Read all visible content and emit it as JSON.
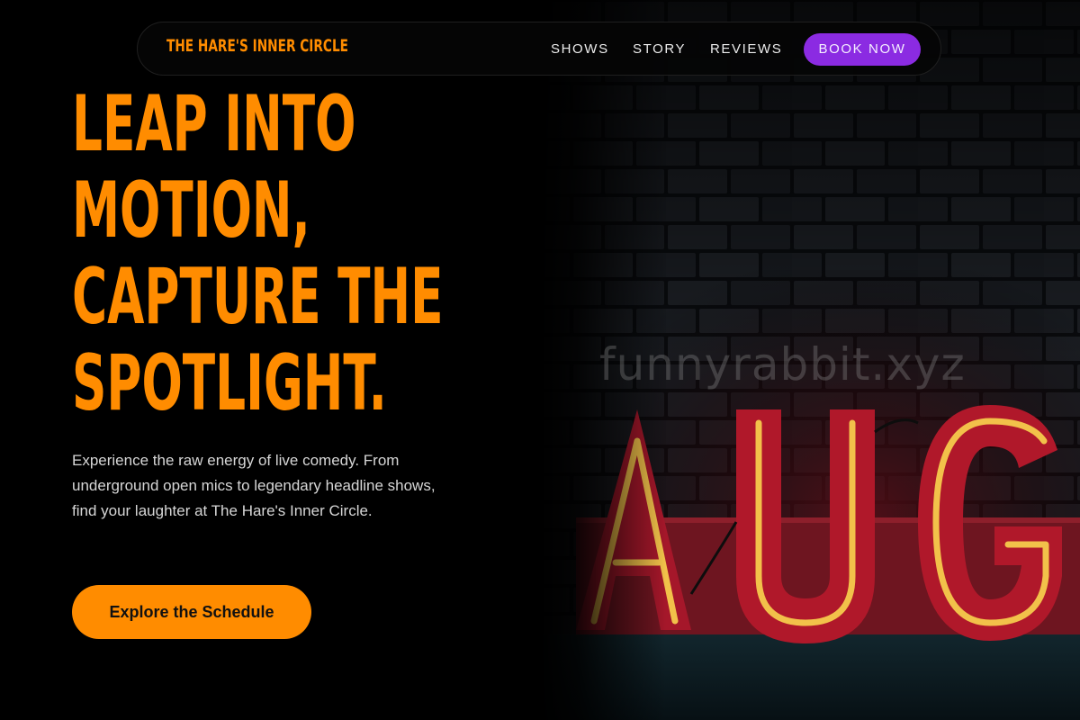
{
  "nav": {
    "brand": "THE HARE'S INNER CIRCLE",
    "links": [
      "SHOWS",
      "STORY",
      "REVIEWS"
    ],
    "cta_label": "BOOK NOW"
  },
  "hero": {
    "headline_lines": [
      "LEAP INTO",
      "MOTION,",
      "CAPTURE THE",
      "SPOTLIGHT."
    ],
    "description": "Experience the raw energy of live comedy. From underground open mics to legendary headline shows, find your laughter at The Hare's Inner Circle.",
    "cta_label": "Explore the Schedule",
    "image": {
      "watermark": "funnyrabbit.xyz",
      "sign_text": "AUG"
    }
  },
  "colors": {
    "accent": "#ff8c00",
    "book_button": "#8b2be2",
    "background": "#000000",
    "neon_tube": "#f2c14a",
    "sign_red": "#b0182a"
  }
}
